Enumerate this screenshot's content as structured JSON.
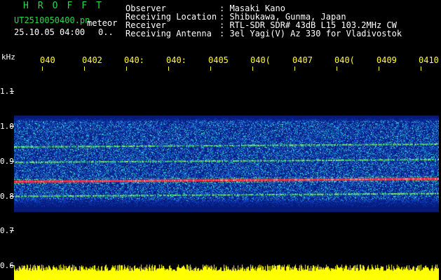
{
  "header": {
    "brand": "HROFFT",
    "filename": "UT2510050400.pn",
    "mode": "meteor",
    "datetime": "25.10.05 04:00",
    "count": "0..",
    "rows": [
      {
        "label": "Observer",
        "value": ": Masaki Kano"
      },
      {
        "label": "Receiving Location",
        "value": ": Shibukawa, Gunma, Japan"
      },
      {
        "label": "Receiver",
        "value": ": RTL-SDR SDR# 43dB L15 103.2MHz CW"
      },
      {
        "label": "Receiving Antenna",
        "value": ": 3el Yagi(V) Az 330 for Vladivostok"
      }
    ]
  },
  "axis": {
    "y_unit": "kHz",
    "y_ticks": [
      "1.1",
      "1.0",
      "0.9",
      "0.8",
      "0.7",
      "0.6"
    ],
    "x_ticks": [
      "040",
      "0402",
      "040:",
      "040:",
      "0405",
      "040(",
      "0407",
      "040(",
      "0409",
      "0410"
    ]
  },
  "colors": {
    "background": "#000000",
    "spectrum_bg": "#0a1e8c",
    "noise_cyan": "#2fd0e0",
    "line_green": "#4fe050",
    "line_red": "#ff3030",
    "floor": "#ffff00"
  },
  "signal_lines_khz": [
    0.942,
    0.898,
    0.842,
    0.801
  ]
}
